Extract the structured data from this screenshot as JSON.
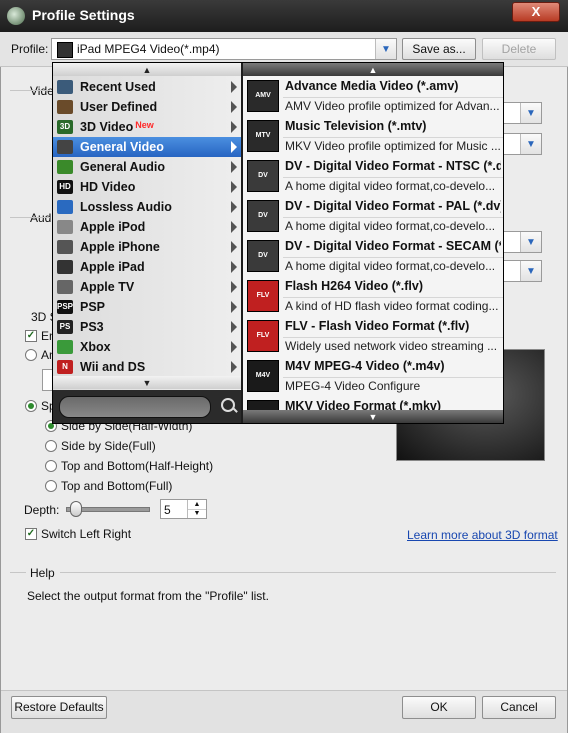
{
  "window": {
    "title": "Profile Settings",
    "close_label": "X"
  },
  "toolbar": {
    "profile_label": "Profile:",
    "profile_value": "iPad MPEG4 Video(*.mp4)",
    "save_as_label": "Save as...",
    "delete_label": "Delete"
  },
  "background": {
    "video_label": "Video",
    "audio_label": "Audio",
    "three_d_label": "3D S",
    "enable_label": "En",
    "anaglyph_label": "An",
    "split_label": "Sp",
    "split_options": [
      "Side by Side(Half-Width)",
      "Side by Side(Full)",
      "Top and Bottom(Half-Height)",
      "Top and Bottom(Full)"
    ],
    "depth_label": "Depth:",
    "depth_value": "5",
    "depth_level": 0.05,
    "switch_label": "Switch Left Right",
    "learn_link": "Learn more about 3D format",
    "help_title": "Help",
    "help_text": "Select the output format from the \"Profile\" list."
  },
  "footer": {
    "restore_label": "Restore Defaults",
    "ok_label": "OK",
    "cancel_label": "Cancel"
  },
  "dropdown": {
    "categories": [
      {
        "label": "Recent Used",
        "icon": "recent-icon",
        "selected": false
      },
      {
        "label": "User Defined",
        "icon": "user-icon",
        "selected": false
      },
      {
        "label": "3D Video",
        "badge": "New",
        "icon": "3d-icon",
        "selected": false
      },
      {
        "label": "General Video",
        "icon": "film-icon",
        "selected": true
      },
      {
        "label": "General Audio",
        "icon": "music-note-icon",
        "selected": false
      },
      {
        "label": "HD Video",
        "icon": "hd-icon",
        "selected": false
      },
      {
        "label": "Lossless Audio",
        "icon": "music-icon",
        "selected": false
      },
      {
        "label": "Apple iPod",
        "icon": "ipod-icon",
        "selected": false
      },
      {
        "label": "Apple iPhone",
        "icon": "iphone-icon",
        "selected": false
      },
      {
        "label": "Apple iPad",
        "icon": "ipad-icon",
        "selected": false
      },
      {
        "label": "Apple TV",
        "icon": "apple-icon",
        "selected": false
      },
      {
        "label": "PSP",
        "icon": "psp-icon",
        "selected": false
      },
      {
        "label": "PS3",
        "icon": "ps3-icon",
        "selected": false
      },
      {
        "label": "Xbox",
        "icon": "xbox-icon",
        "selected": false
      },
      {
        "label": "Wii and DS",
        "icon": "nintendo-icon",
        "selected": false
      }
    ],
    "icon_text": {
      "3d-icon": "3D",
      "hd-icon": "HD",
      "psp-icon": "PSP",
      "ps3-icon": "PS",
      "nintendo-icon": "N"
    },
    "formats": [
      {
        "name": "Advance Media Video (*.amv)",
        "desc": "AMV Video profile optimized for Advan...",
        "icon": "amv-icon",
        "icon_text": "AMV"
      },
      {
        "name": "Music Television (*.mtv)",
        "desc": "MKV Video profile optimized for Music ...",
        "icon": "mtv-icon",
        "icon_text": "MTV"
      },
      {
        "name": "DV - Digital Video Format - NTSC (*.dv)",
        "desc": "A home digital video format,co-develo...",
        "icon": "camcorder-icon",
        "icon_text": "DV"
      },
      {
        "name": "DV - Digital Video Format - PAL (*.dv)",
        "desc": "A home digital video format,co-develo...",
        "icon": "camcorder-icon",
        "icon_text": "DV"
      },
      {
        "name": "DV - Digital Video Format - SECAM (*.dv)",
        "desc": "A home digital video format,co-develo...",
        "icon": "camcorder-icon",
        "icon_text": "DV"
      },
      {
        "name": "Flash H264 Video (*.flv)",
        "desc": "A kind of HD flash video format coding...",
        "icon": "flv-icon",
        "icon_text": "FLV"
      },
      {
        "name": "FLV - Flash Video Format (*.flv)",
        "desc": "Widely used network video streaming ...",
        "icon": "flv-icon",
        "icon_text": "FLV"
      },
      {
        "name": "M4V MPEG-4 Video (*.m4v)",
        "desc": "MPEG-4 Video Configure",
        "icon": "m4v-icon",
        "icon_text": "M4V"
      },
      {
        "name": "MKV Video Format (*.mkv)",
        "desc": "",
        "icon": "mkv-icon",
        "icon_text": "MKV"
      }
    ]
  },
  "colors": {
    "selection": "#2f72d1",
    "accent": "#2a66bb",
    "dropdown_bg": "#1d1d1d"
  }
}
